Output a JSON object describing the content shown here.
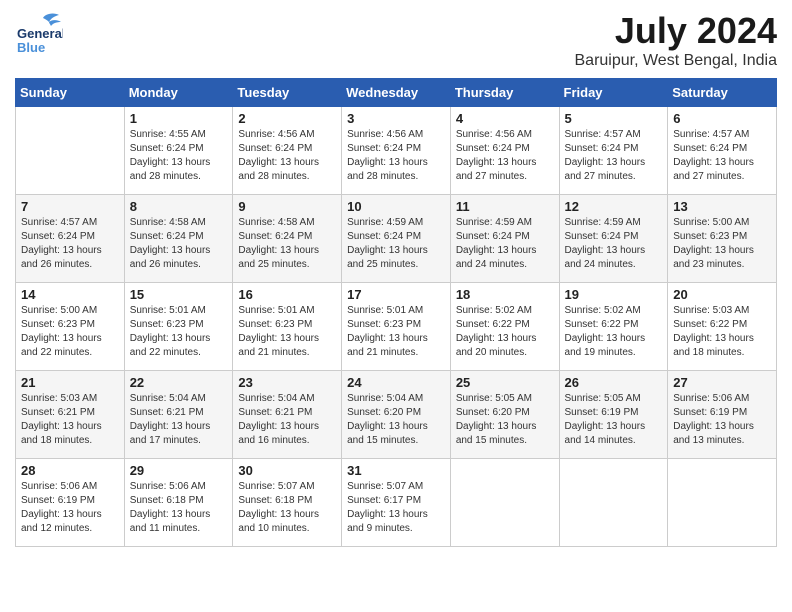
{
  "header": {
    "logo_line1": "General",
    "logo_line2": "Blue",
    "month": "July 2024",
    "location": "Baruipur, West Bengal, India"
  },
  "days_of_week": [
    "Sunday",
    "Monday",
    "Tuesday",
    "Wednesday",
    "Thursday",
    "Friday",
    "Saturday"
  ],
  "weeks": [
    [
      {
        "day": "",
        "info": ""
      },
      {
        "day": "1",
        "info": "Sunrise: 4:55 AM\nSunset: 6:24 PM\nDaylight: 13 hours\nand 28 minutes."
      },
      {
        "day": "2",
        "info": "Sunrise: 4:56 AM\nSunset: 6:24 PM\nDaylight: 13 hours\nand 28 minutes."
      },
      {
        "day": "3",
        "info": "Sunrise: 4:56 AM\nSunset: 6:24 PM\nDaylight: 13 hours\nand 28 minutes."
      },
      {
        "day": "4",
        "info": "Sunrise: 4:56 AM\nSunset: 6:24 PM\nDaylight: 13 hours\nand 27 minutes."
      },
      {
        "day": "5",
        "info": "Sunrise: 4:57 AM\nSunset: 6:24 PM\nDaylight: 13 hours\nand 27 minutes."
      },
      {
        "day": "6",
        "info": "Sunrise: 4:57 AM\nSunset: 6:24 PM\nDaylight: 13 hours\nand 27 minutes."
      }
    ],
    [
      {
        "day": "7",
        "info": "Sunrise: 4:57 AM\nSunset: 6:24 PM\nDaylight: 13 hours\nand 26 minutes."
      },
      {
        "day": "8",
        "info": "Sunrise: 4:58 AM\nSunset: 6:24 PM\nDaylight: 13 hours\nand 26 minutes."
      },
      {
        "day": "9",
        "info": "Sunrise: 4:58 AM\nSunset: 6:24 PM\nDaylight: 13 hours\nand 25 minutes."
      },
      {
        "day": "10",
        "info": "Sunrise: 4:59 AM\nSunset: 6:24 PM\nDaylight: 13 hours\nand 25 minutes."
      },
      {
        "day": "11",
        "info": "Sunrise: 4:59 AM\nSunset: 6:24 PM\nDaylight: 13 hours\nand 24 minutes."
      },
      {
        "day": "12",
        "info": "Sunrise: 4:59 AM\nSunset: 6:24 PM\nDaylight: 13 hours\nand 24 minutes."
      },
      {
        "day": "13",
        "info": "Sunrise: 5:00 AM\nSunset: 6:23 PM\nDaylight: 13 hours\nand 23 minutes."
      }
    ],
    [
      {
        "day": "14",
        "info": "Sunrise: 5:00 AM\nSunset: 6:23 PM\nDaylight: 13 hours\nand 22 minutes."
      },
      {
        "day": "15",
        "info": "Sunrise: 5:01 AM\nSunset: 6:23 PM\nDaylight: 13 hours\nand 22 minutes."
      },
      {
        "day": "16",
        "info": "Sunrise: 5:01 AM\nSunset: 6:23 PM\nDaylight: 13 hours\nand 21 minutes."
      },
      {
        "day": "17",
        "info": "Sunrise: 5:01 AM\nSunset: 6:23 PM\nDaylight: 13 hours\nand 21 minutes."
      },
      {
        "day": "18",
        "info": "Sunrise: 5:02 AM\nSunset: 6:22 PM\nDaylight: 13 hours\nand 20 minutes."
      },
      {
        "day": "19",
        "info": "Sunrise: 5:02 AM\nSunset: 6:22 PM\nDaylight: 13 hours\nand 19 minutes."
      },
      {
        "day": "20",
        "info": "Sunrise: 5:03 AM\nSunset: 6:22 PM\nDaylight: 13 hours\nand 18 minutes."
      }
    ],
    [
      {
        "day": "21",
        "info": "Sunrise: 5:03 AM\nSunset: 6:21 PM\nDaylight: 13 hours\nand 18 minutes."
      },
      {
        "day": "22",
        "info": "Sunrise: 5:04 AM\nSunset: 6:21 PM\nDaylight: 13 hours\nand 17 minutes."
      },
      {
        "day": "23",
        "info": "Sunrise: 5:04 AM\nSunset: 6:21 PM\nDaylight: 13 hours\nand 16 minutes."
      },
      {
        "day": "24",
        "info": "Sunrise: 5:04 AM\nSunset: 6:20 PM\nDaylight: 13 hours\nand 15 minutes."
      },
      {
        "day": "25",
        "info": "Sunrise: 5:05 AM\nSunset: 6:20 PM\nDaylight: 13 hours\nand 15 minutes."
      },
      {
        "day": "26",
        "info": "Sunrise: 5:05 AM\nSunset: 6:19 PM\nDaylight: 13 hours\nand 14 minutes."
      },
      {
        "day": "27",
        "info": "Sunrise: 5:06 AM\nSunset: 6:19 PM\nDaylight: 13 hours\nand 13 minutes."
      }
    ],
    [
      {
        "day": "28",
        "info": "Sunrise: 5:06 AM\nSunset: 6:19 PM\nDaylight: 13 hours\nand 12 minutes."
      },
      {
        "day": "29",
        "info": "Sunrise: 5:06 AM\nSunset: 6:18 PM\nDaylight: 13 hours\nand 11 minutes."
      },
      {
        "day": "30",
        "info": "Sunrise: 5:07 AM\nSunset: 6:18 PM\nDaylight: 13 hours\nand 10 minutes."
      },
      {
        "day": "31",
        "info": "Sunrise: 5:07 AM\nSunset: 6:17 PM\nDaylight: 13 hours\nand 9 minutes."
      },
      {
        "day": "",
        "info": ""
      },
      {
        "day": "",
        "info": ""
      },
      {
        "day": "",
        "info": ""
      }
    ]
  ]
}
